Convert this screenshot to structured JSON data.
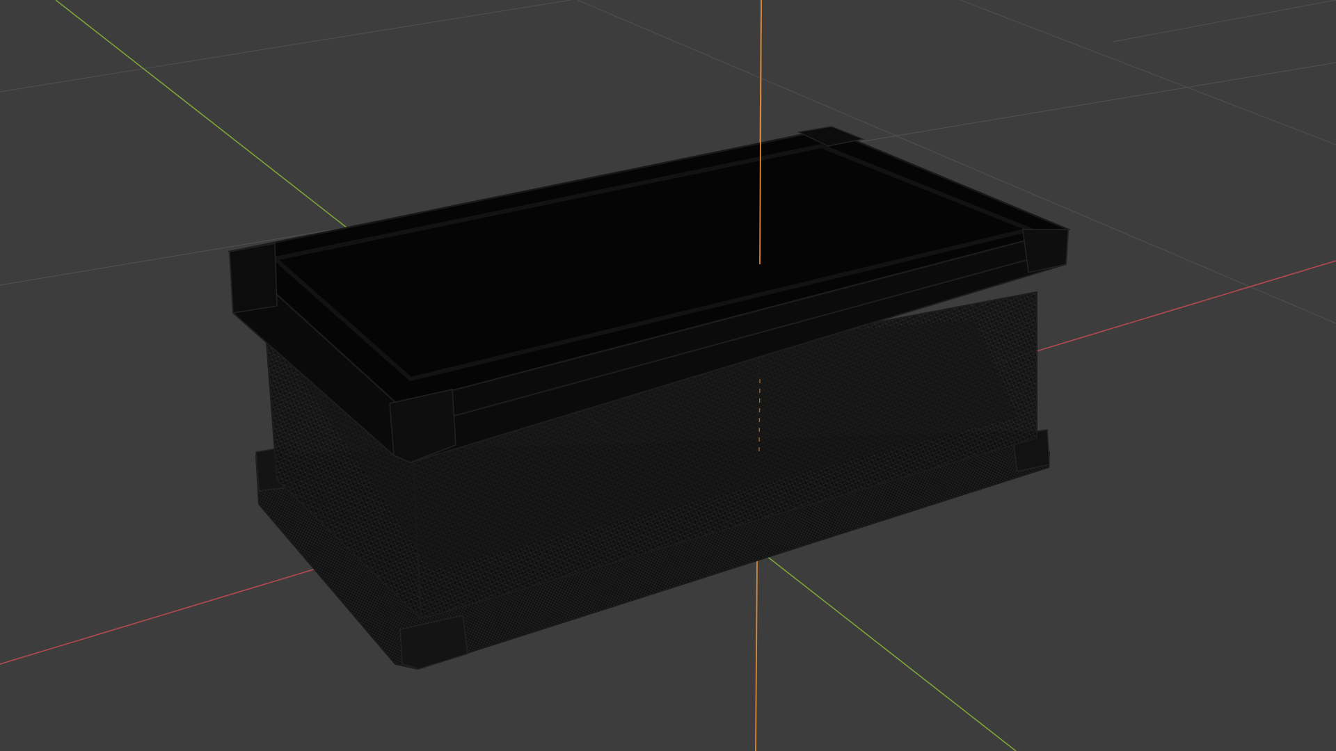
{
  "viewport": {
    "background": "#3d3d3d",
    "grid_color": "#4e4e4e",
    "axis_x_color": "#b34a4f",
    "axis_y_color": "#7fa33b",
    "axis_z_color": "#d8893a",
    "mesh_fill": "#0d0d0d",
    "mesh_edge_color": "#262626",
    "view_mode": "wireframe-overlay",
    "object_name": "crate-mesh"
  }
}
